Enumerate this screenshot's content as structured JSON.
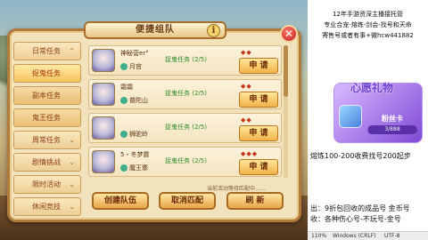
{
  "panel": {
    "title": "便捷组队",
    "info_icon": "i",
    "close_icon": "✕"
  },
  "tabs": [
    {
      "label": "日常任务",
      "chevron": "⌃"
    },
    {
      "label": "捉鬼任务",
      "sub": true,
      "active": true
    },
    {
      "label": "副本任务",
      "sub": true
    },
    {
      "label": "鬼王任务",
      "sub": true
    },
    {
      "label": "周常任务",
      "chevron": "⌄"
    },
    {
      "label": "剧情挑战",
      "chevron": "⌄"
    },
    {
      "label": "限时活动",
      "chevron": "⌄"
    },
    {
      "label": "休闲竞技",
      "chevron": "⌄"
    }
  ],
  "rows": [
    {
      "level": "",
      "name": "神秘营er°",
      "sect": "月宫",
      "task": "捉鬼任务 (2/5)",
      "apply": "申 请"
    },
    {
      "level": "",
      "name": "霜霜",
      "sect": "普陀山",
      "task": "捉鬼任务 (2/5)",
      "apply": "申 请"
    },
    {
      "level": "",
      "name": "",
      "sect": "狮驼岭",
      "task": "捉鬼任务 (2/5)",
      "apply": "申 请"
    },
    {
      "level": "",
      "name": "5・冬梦霆",
      "sect": "魔王寨",
      "task": "捉鬼任务 (2/5)",
      "apply": "申 请"
    }
  ],
  "status_line": "当前活动等待匹配中……",
  "buttons": {
    "create": "创建队伍",
    "cancel": "取消匹配",
    "refresh": "刷 新"
  },
  "overlay": {
    "line1": "12年手游资深主播接托管",
    "line2": "专业合宠-熔炼-剑会-找号和天命",
    "line3": "寄售号或者有事+微hcw441882",
    "wish_title": "心愿礼物",
    "wish_item": "粉丝卡",
    "wish_progress_text": "3/888",
    "wish_progress": 0.0034,
    "line4": "熔炼100-200收费找号200起步",
    "line5": "出：9折包回收的成品号 金币号",
    "line6": "收：各种伤心号-不玩号-金号"
  },
  "statusbar": {
    "zoom": "110%",
    "encoding_eol": "Windows (CRLF)",
    "charset": "UTF-8"
  }
}
